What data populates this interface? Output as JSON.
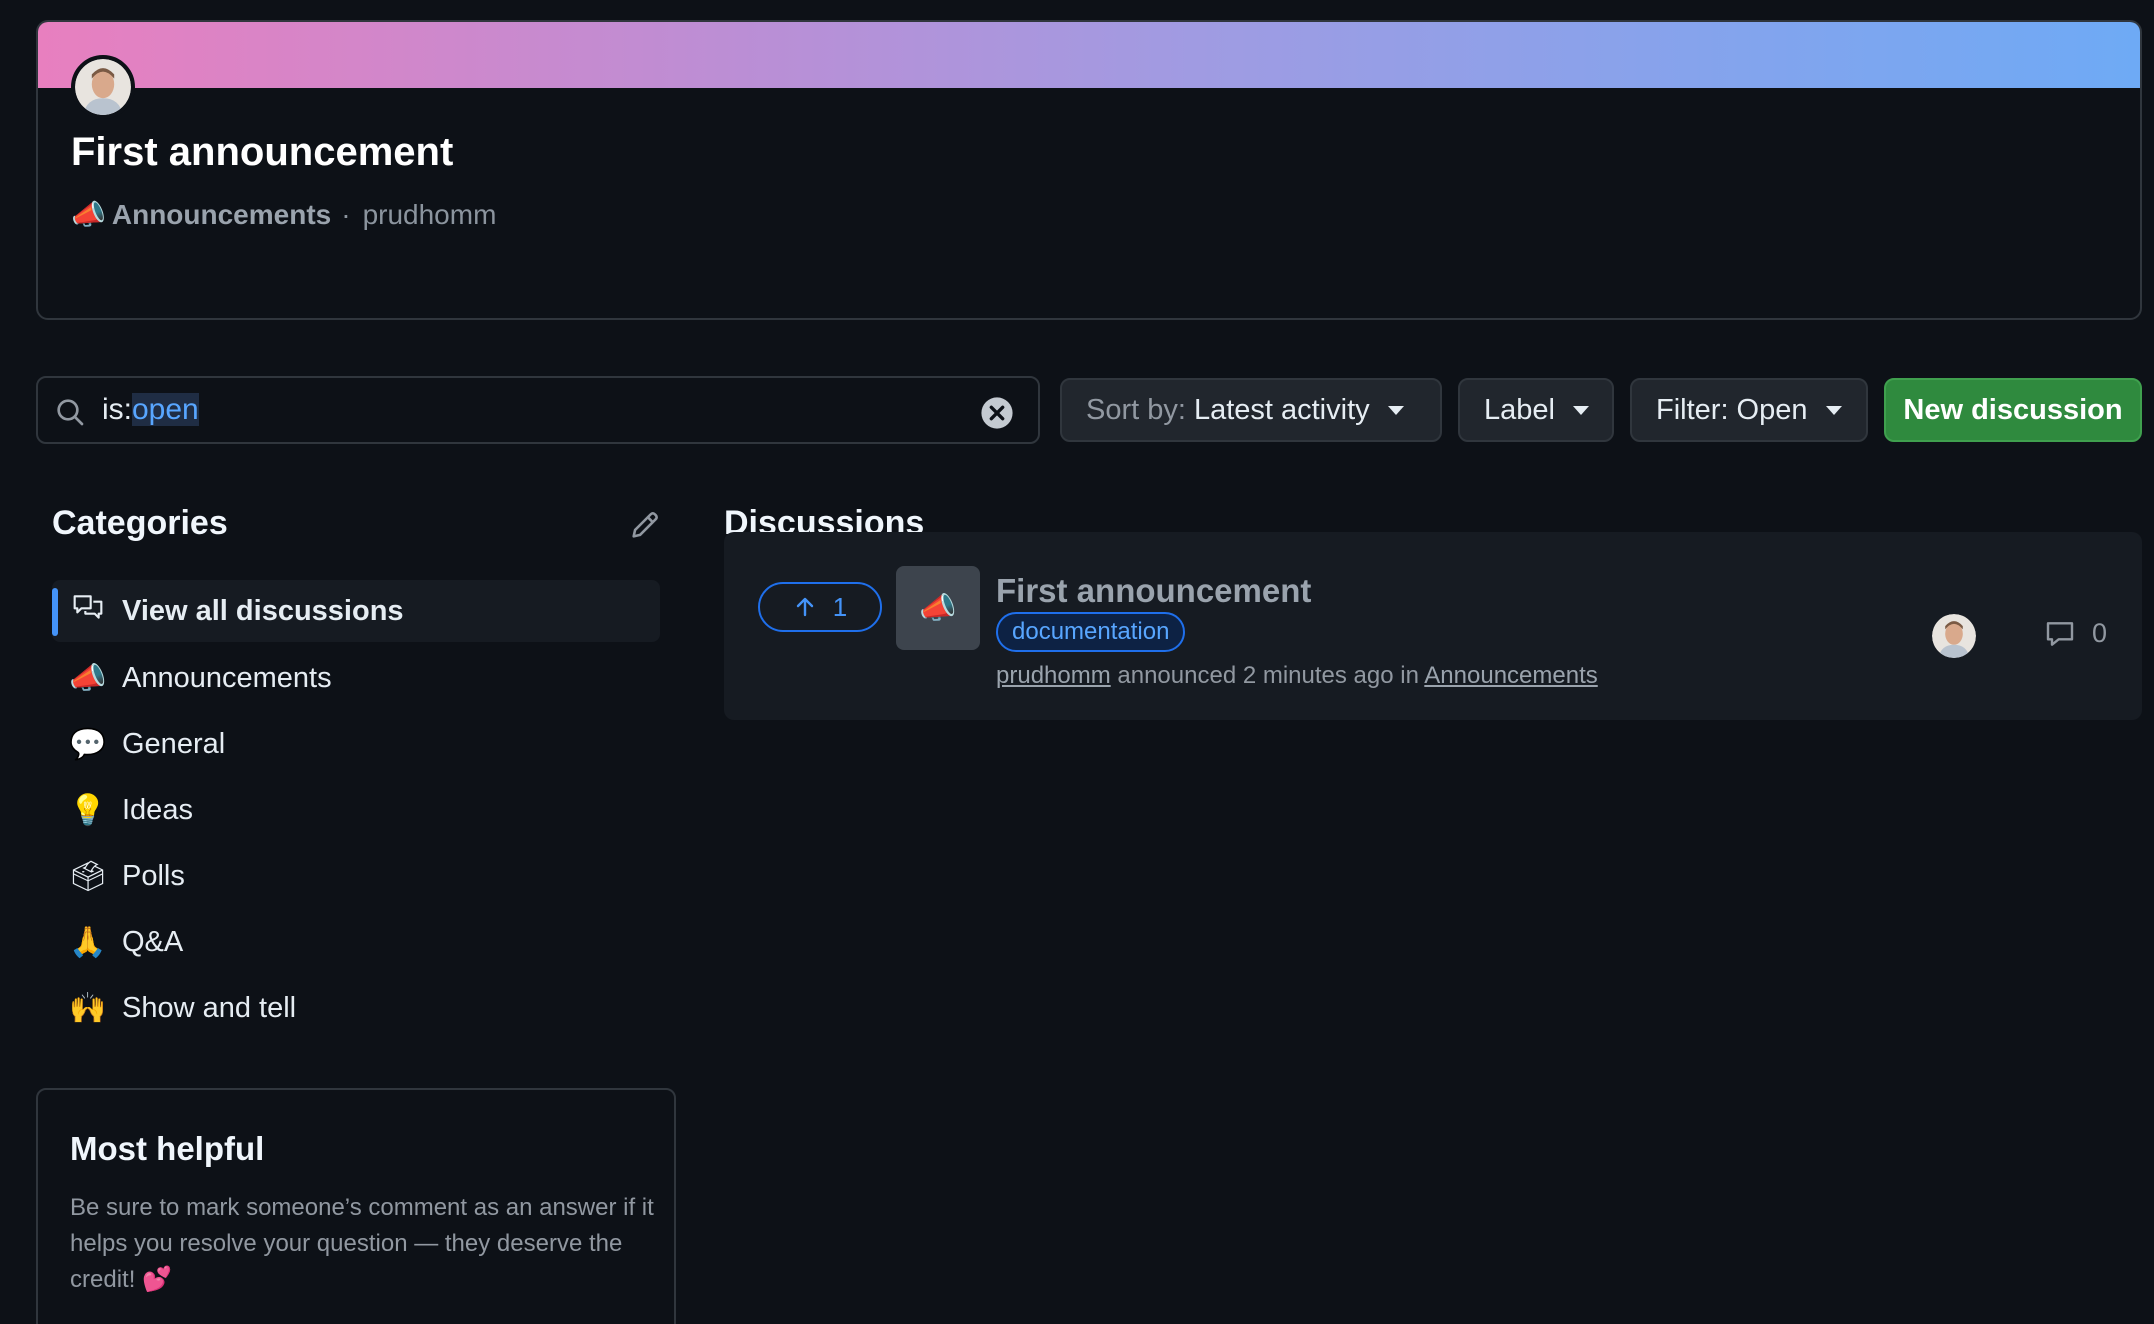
{
  "announcement": {
    "title": "First announcement",
    "category_emoji": "📣",
    "category": "Announcements",
    "separator": "·",
    "author": "prudhomm"
  },
  "search": {
    "prefix": "is:",
    "highlighted": "open"
  },
  "toolbar": {
    "sort_prefix": "Sort by:",
    "sort_value": "Latest activity",
    "label": "Label",
    "filter": "Filter: Open",
    "new_discussion": "New discussion"
  },
  "categories": {
    "heading": "Categories",
    "items": [
      {
        "emoji": "",
        "label": "View all discussions"
      },
      {
        "emoji": "📣",
        "label": "Announcements"
      },
      {
        "emoji": "💬",
        "label": "General"
      },
      {
        "emoji": "💡",
        "label": "Ideas"
      },
      {
        "emoji": "🗳",
        "label": "Polls"
      },
      {
        "emoji": "🙏",
        "label": "Q&A"
      },
      {
        "emoji": "🙌",
        "label": "Show and tell"
      }
    ]
  },
  "most_helpful": {
    "title": "Most helpful",
    "text": "Be sure to mark someone’s comment as an answer if it helps you resolve your question — they deserve the credit! 💕"
  },
  "discussions": {
    "heading": "Discussions",
    "item": {
      "upvotes": "1",
      "category_emoji": "📣",
      "title": "First announcement",
      "label": "documentation",
      "author": "prudhomm",
      "action": "announced 2 minutes ago in",
      "category": "Announcements",
      "comments": "0"
    }
  },
  "colors": {
    "background": "#0d1117",
    "accent": "#4493f8",
    "primary_button": "#2f8a3e",
    "banner_start": "#e87fbf",
    "banner_end": "#6eaaf5"
  }
}
